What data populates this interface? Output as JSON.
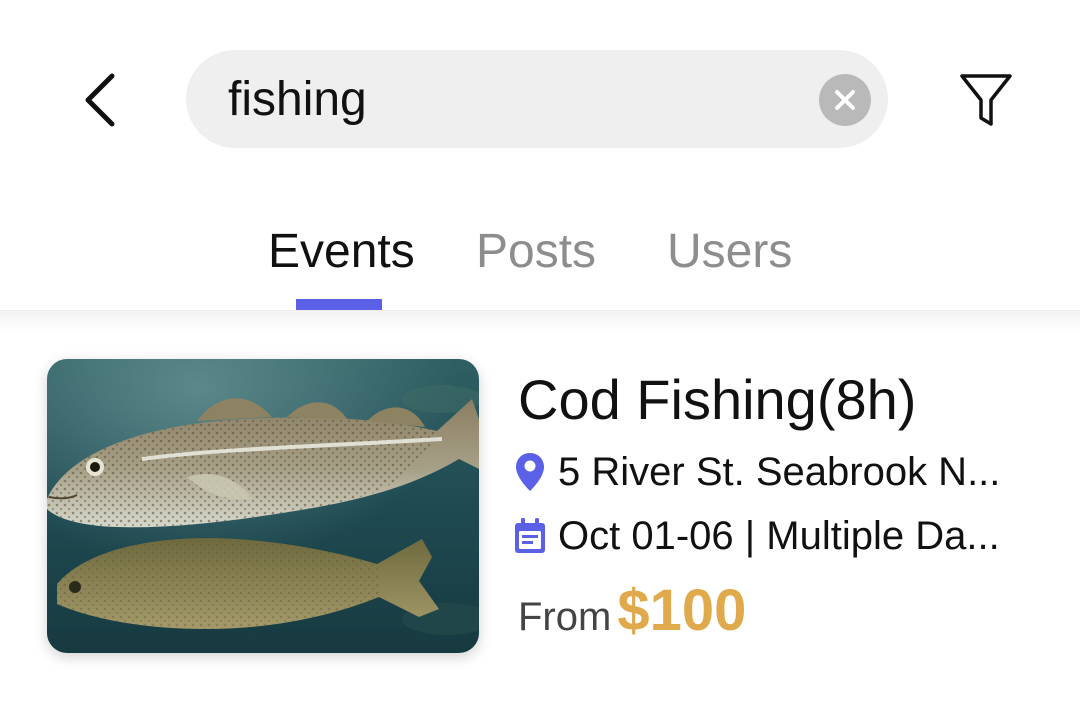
{
  "search": {
    "query": "fishing"
  },
  "tabs": [
    {
      "label": "Events"
    },
    {
      "label": "Posts"
    },
    {
      "label": "Users"
    }
  ],
  "active_tab": "Events",
  "colors": {
    "accent": "#5b61e6",
    "price": "#e0a94c",
    "icon": "#5b61e6"
  },
  "icons": {
    "back": "chevron-left-icon",
    "clear": "clear-x-icon",
    "filter": "funnel-icon",
    "location": "location-pin-icon",
    "date": "calendar-icon"
  },
  "results": [
    {
      "title": "Cod Fishing(8h)",
      "location": "5 River St. Seabrook N...",
      "dates": "Oct 01-06 | Multiple Da...",
      "price_prefix": "From",
      "price": "$100"
    }
  ]
}
